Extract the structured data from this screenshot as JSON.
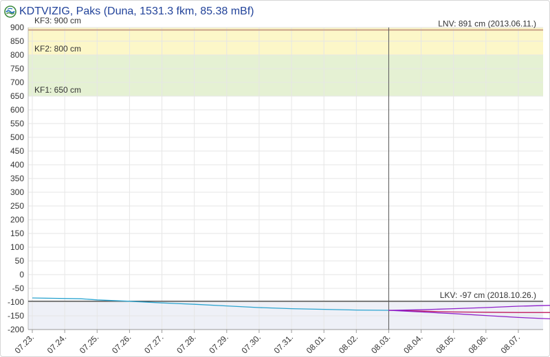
{
  "header": {
    "logo_icon": "kdtvizig-water-logo-icon",
    "title": "KDTVIZIG, Paks (Duna, 1531.3 fkm, 85.38 mBf)"
  },
  "colors": {
    "title": "#22439a",
    "band_kf3": "#fcf7c8",
    "band_kf2_kf1": "#e5f1d3",
    "band_below": "#eef0f7",
    "observed": "#2aa3cf",
    "forecast_mid": "#c0185b",
    "forecast_bounds": "#8e1fc9",
    "lnv_line": "#c9a188",
    "lkv_line": "#555555"
  },
  "chart_data": {
    "type": "line",
    "y_unit": "cm",
    "ylim": [
      -200,
      900
    ],
    "y_ticks": [
      "900",
      "850",
      "800",
      "750",
      "700",
      "650",
      "600",
      "550",
      "500",
      "450",
      "400",
      "350",
      "300",
      "250",
      "200",
      "150",
      "100",
      "50",
      "0",
      "-50",
      "-100",
      "-150",
      "-200"
    ],
    "x_range": [
      "07.23. 00:00",
      "08.07. 12:00"
    ],
    "x_ticks": [
      "07.23.",
      "07.24.",
      "07.25.",
      "07.26.",
      "07.27.",
      "07.28.",
      "07.29.",
      "07.30.",
      "07.31.",
      "08.01.",
      "08.02.",
      "08.03.",
      "08.04.",
      "08.05.",
      "08.06.",
      "08.07."
    ],
    "grid": true,
    "now_marker": "08.02. 00:00",
    "thresholds": [
      {
        "label": "KF3: 900 cm",
        "value": 900
      },
      {
        "label": "KF2: 800 cm",
        "value": 800
      },
      {
        "label": "KF1: 650 cm",
        "value": 650
      }
    ],
    "records": [
      {
        "label": "LNV: 891 cm (2013.06.11.)",
        "value": 891
      },
      {
        "label": "LKV: -97 cm (2018.10.26.)",
        "value": -97
      }
    ],
    "series": [
      {
        "role": "observed",
        "points": [
          [
            "07.23. 00:00",
            -85
          ],
          [
            "07.24. 00:00",
            -87
          ],
          [
            "07.24. 12:00",
            -88
          ],
          [
            "07.25. 00:00",
            -92
          ],
          [
            "07.26. 00:00",
            -97
          ],
          [
            "07.27. 00:00",
            -103
          ],
          [
            "07.28. 00:00",
            -108
          ],
          [
            "07.29. 00:00",
            -114
          ],
          [
            "07.30. 00:00",
            -120
          ],
          [
            "07.31. 00:00",
            -124
          ],
          [
            "08.01. 00:00",
            -129
          ],
          [
            "08.02. 00:00",
            -130
          ]
        ]
      },
      {
        "role": "forecast-middle",
        "points": [
          [
            "08.02. 00:00",
            -130
          ],
          [
            "08.03. 00:00",
            -133
          ],
          [
            "08.04. 00:00",
            -136
          ],
          [
            "08.05. 00:00",
            -137
          ],
          [
            "08.06. 00:00",
            -138
          ],
          [
            "08.07. 00:00",
            -138
          ],
          [
            "08.07. 06:00",
            -138
          ]
        ]
      },
      {
        "role": "forecast-upper",
        "points": [
          [
            "08.02. 00:00",
            -130
          ],
          [
            "08.03. 00:00",
            -128
          ],
          [
            "08.04. 00:00",
            -124
          ],
          [
            "08.05. 00:00",
            -120
          ],
          [
            "08.06. 00:00",
            -115
          ],
          [
            "08.07. 00:00",
            -112
          ],
          [
            "08.07. 06:00",
            -110
          ]
        ]
      },
      {
        "role": "forecast-lower",
        "points": [
          [
            "08.02. 00:00",
            -130
          ],
          [
            "08.03. 00:00",
            -136
          ],
          [
            "08.04. 00:00",
            -142
          ],
          [
            "08.05. 00:00",
            -149
          ],
          [
            "08.06. 00:00",
            -156
          ],
          [
            "08.07. 00:00",
            -161
          ],
          [
            "08.07. 06:00",
            -163
          ]
        ]
      }
    ]
  }
}
